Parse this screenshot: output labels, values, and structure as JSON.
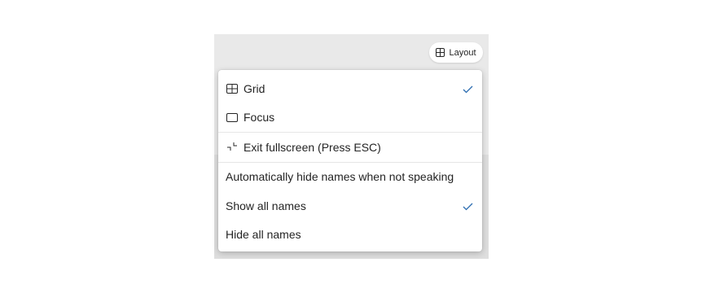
{
  "toolbar": {
    "layout_label": "Layout",
    "layout_icon": "grid-icon"
  },
  "menu": {
    "items": [
      {
        "label": "Grid",
        "icon": "grid-icon",
        "checked": true
      },
      {
        "label": "Focus",
        "icon": "focus-rectangle-icon",
        "checked": false
      },
      {
        "label": "Exit fullscreen (Press ESC)",
        "icon": "exit-fullscreen-icon",
        "checked": false
      },
      {
        "label": "Automatically hide names when not speaking",
        "icon": "",
        "checked": false
      },
      {
        "label": "Show all names",
        "icon": "",
        "checked": true
      },
      {
        "label": "Hide all names",
        "icon": "",
        "checked": false
      }
    ]
  },
  "colors": {
    "accent_check": "#2b6cb0",
    "menu_background": "#ffffff",
    "stage_background": "#e9e9e9"
  }
}
